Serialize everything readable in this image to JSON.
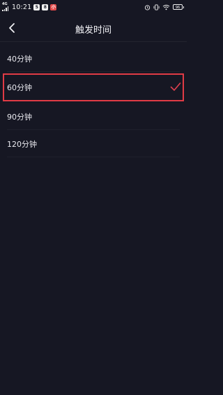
{
  "status_bar": {
    "network": "4G",
    "time": "10:21",
    "notifications": [
      "5",
      "8",
      "小"
    ],
    "battery": "96"
  },
  "header": {
    "title": "触发时间"
  },
  "options": [
    {
      "label": "40分钟",
      "selected": false
    },
    {
      "label": "60分钟",
      "selected": true
    },
    {
      "label": "90分钟",
      "selected": false
    },
    {
      "label": "120分钟",
      "selected": false
    }
  ],
  "colors": {
    "background": "#161723",
    "accent": "#e0404f",
    "highlight_border": "#e03b45"
  }
}
